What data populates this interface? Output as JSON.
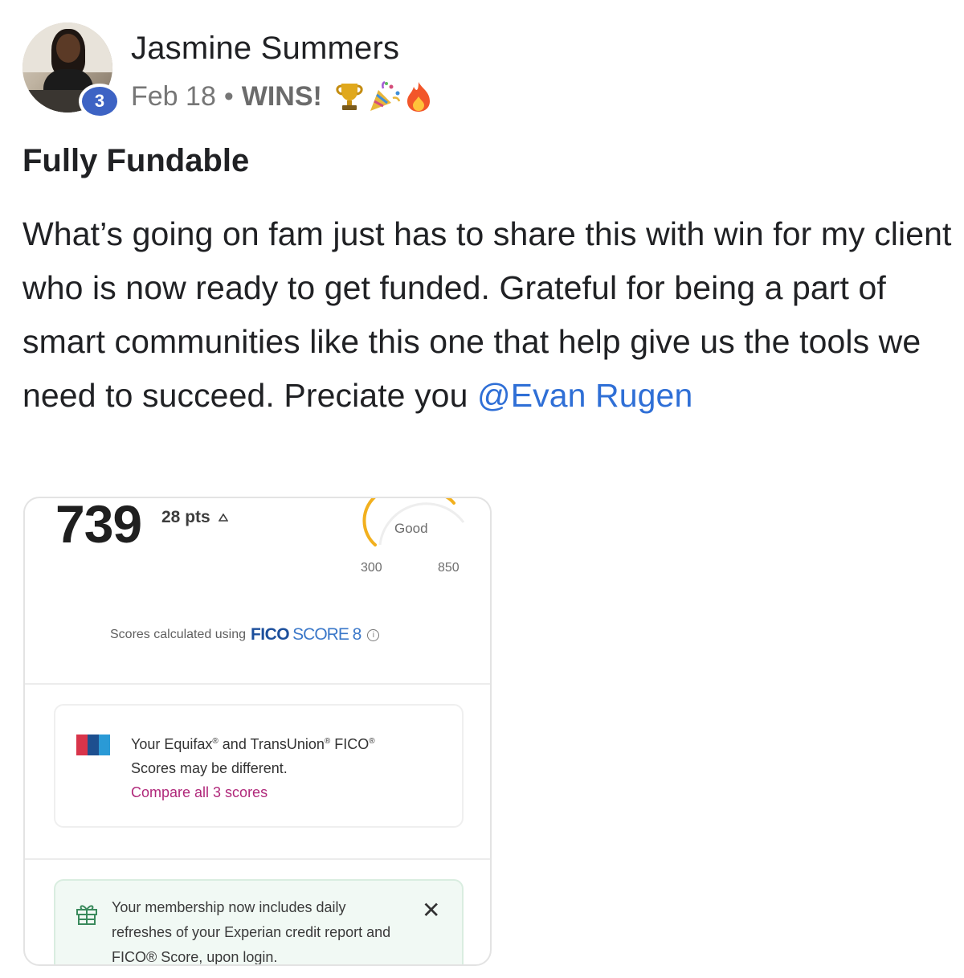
{
  "post": {
    "author": "Jasmine Summers",
    "level": "3",
    "date": "Feb 18",
    "separator": "•",
    "category": "WINS!",
    "category_emojis": [
      "trophy-icon",
      "party-popper-icon",
      "fire-icon"
    ],
    "title": "Fully Fundable",
    "body": "What’s going on fam just has to share this with win for my client who is now ready to get funded. Grateful for being a part of smart communities like this one that help give us the tools we need to succeed. Preciate you ",
    "mention": "@Evan Rugen"
  },
  "attachment": {
    "score": "739",
    "score_change": "28 pts",
    "rating": "Good",
    "range_min": "300",
    "range_max": "850",
    "score_fraction": 0.81,
    "calc_text": "Scores calculated using",
    "calc_brand": "FICO",
    "calc_model": "SCORE 8",
    "bureau_line1_a": "Your Equifax",
    "bureau_line1_b": " and TransUnion",
    "bureau_line1_c": " FICO",
    "bureau_reg": "®",
    "bureau_line2": "Scores may be different.",
    "compare_link": "Compare all 3 scores",
    "promo_text": "Your membership now includes daily refreshes of your Experian credit report and FICO® Score, upon login.",
    "close_glyph": "✕"
  },
  "colors": {
    "badge": "#3d63c4",
    "mention": "#2f6fd6",
    "gauge": "#f2b01e",
    "fico_brand": "#1c4f9c",
    "compare_link": "#b0287a",
    "promo_bg": "#f1f9f4"
  }
}
